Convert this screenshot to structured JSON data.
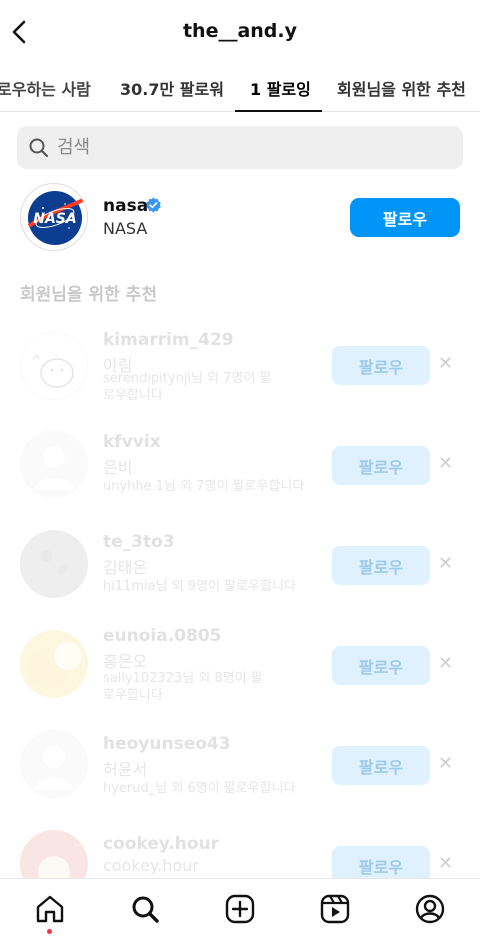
{
  "header": {
    "title": "the__and.y"
  },
  "tabs": [
    {
      "label": "로우하는 사람"
    },
    {
      "label": "30.7만 팔로워"
    },
    {
      "label": "1 팔로잉"
    },
    {
      "label": "회원님을 위한 추천"
    }
  ],
  "search": {
    "placeholder": "검색"
  },
  "following": [
    {
      "username": "nasa",
      "name": "NASA",
      "verified": true,
      "button": "팔로우",
      "logo_text": "NASA"
    }
  ],
  "suggestions_title": "회원님을 위한 추천",
  "suggestions": [
    {
      "username": "kimarrim_429",
      "name": "아림",
      "context": "serendipitynji님 외 7명이 팔로우합니다",
      "button": "팔로우"
    },
    {
      "username": "kfvvix",
      "name": "은비",
      "context": "unyhhe.1님 외 7명이 팔로우합니다",
      "button": "팔로우"
    },
    {
      "username": "te_3to3",
      "name": "김태은",
      "context": "hi11mia님 외 9명이 팔로우합니다",
      "button": "팔로우"
    },
    {
      "username": "eunoia.0805",
      "name": "홍은오",
      "context": "sally102323님 외 8명이 팔로우합니다",
      "button": "팔로우"
    },
    {
      "username": "heoyunseo43",
      "name": "허윤서",
      "context": "hyerud_님 외 6명이 팔로우합니다",
      "button": "팔로우"
    },
    {
      "username": "cookey.hour",
      "name": "cookey.hour",
      "context": "",
      "button": "팔로우"
    }
  ],
  "colors": {
    "accent": "#0095f6",
    "notification": "#ff3040"
  },
  "nav": [
    "home-icon",
    "search-icon",
    "create-icon",
    "reels-icon",
    "profile-icon"
  ]
}
